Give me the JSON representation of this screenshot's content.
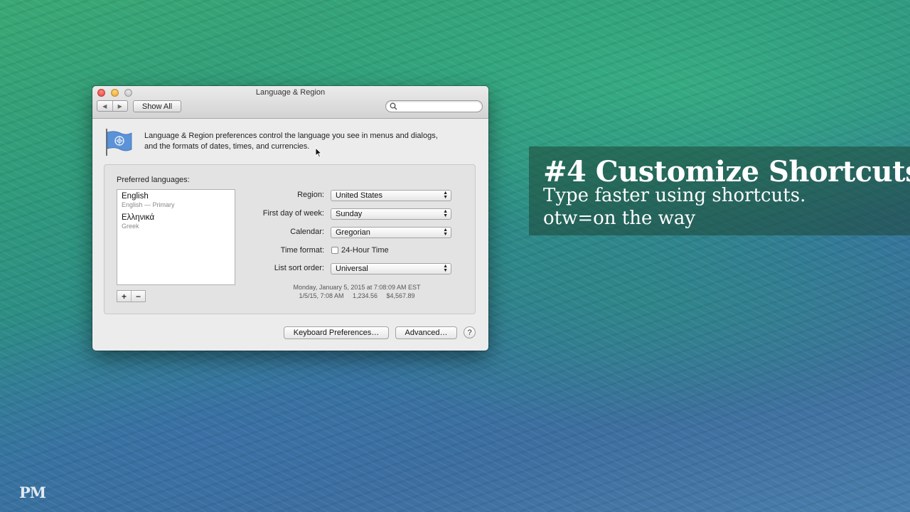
{
  "window": {
    "title": "Language & Region",
    "show_all_label": "Show All",
    "search_placeholder": "",
    "description_line1": "Language & Region preferences control the language you see in menus and dialogs,",
    "description_line2": "and the formats of dates, times, and currencies."
  },
  "languages": {
    "header": "Preferred languages:",
    "items": [
      {
        "name": "English",
        "subtitle": "English — Primary"
      },
      {
        "name": "Ελληνικά",
        "subtitle": "Greek"
      }
    ],
    "add_label": "+",
    "remove_label": "−"
  },
  "settings": {
    "region_label": "Region:",
    "region_value": "United States",
    "first_day_label": "First day of week:",
    "first_day_value": "Sunday",
    "calendar_label": "Calendar:",
    "calendar_value": "Gregorian",
    "time_format_label": "Time format:",
    "time_format_option": "24-Hour Time",
    "time_format_checked": false,
    "sort_label": "List sort order:",
    "sort_value": "Universal",
    "sample_line1": "Monday, January 5, 2015 at 7:08:09 AM EST",
    "sample_line2": "1/5/15, 7:08 AM     1,234.56     $4,567.89"
  },
  "buttons": {
    "keyboard": "Keyboard Preferences…",
    "advanced": "Advanced…",
    "help": "?"
  },
  "overlay": {
    "title": "#4 Customize Shortcuts",
    "line1": "Type faster using shortcuts.",
    "line2": "otw=on the way",
    "logo": "PM"
  }
}
